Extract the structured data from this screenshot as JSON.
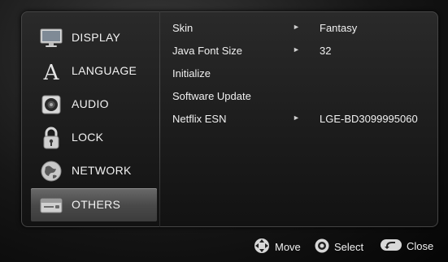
{
  "sidebar": {
    "items": [
      {
        "label": "DISPLAY",
        "icon": "display-icon"
      },
      {
        "label": "LANGUAGE",
        "icon": "language-icon"
      },
      {
        "label": "AUDIO",
        "icon": "audio-icon"
      },
      {
        "label": "LOCK",
        "icon": "lock-icon"
      },
      {
        "label": "NETWORK",
        "icon": "network-icon"
      },
      {
        "label": "OTHERS",
        "icon": "others-icon",
        "selected": true
      }
    ]
  },
  "settings": [
    {
      "name": "Skin",
      "value": "Fantasy"
    },
    {
      "name": "Java Font Size",
      "value": "32"
    },
    {
      "name": "Initialize",
      "value": ""
    },
    {
      "name": "Software Update",
      "value": ""
    },
    {
      "name": "Netflix ESN",
      "value": "LGE-BD3099995060"
    }
  ],
  "footer": {
    "move_label": "Move",
    "select_label": "Select",
    "close_label": "Close"
  },
  "colors": {
    "text": "#f0f0f0",
    "selected_bg": "#555555"
  }
}
